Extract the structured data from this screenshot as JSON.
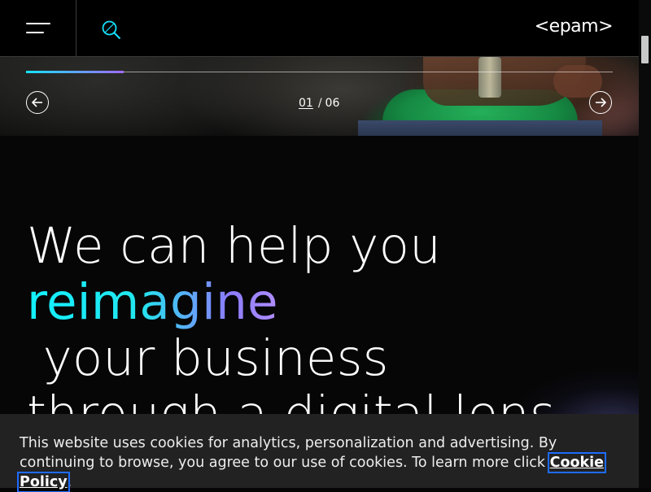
{
  "header": {
    "logo_text": "<epam>",
    "icons": {
      "menu": "hamburger-icon",
      "search": "search-icon"
    },
    "accent_color": "#14e3ff"
  },
  "carousel": {
    "current": "01",
    "separator": "/",
    "total": "06",
    "progress_fraction": 0.1667,
    "icons": {
      "prev": "arrow-left-icon",
      "next": "arrow-right-icon"
    }
  },
  "headline": {
    "line1": "We can help you",
    "highlight": "reimagine",
    "line2_rest": " your business",
    "line3": "through a digital lens.",
    "highlight_gradient": [
      "#13f0ff",
      "#b08dff"
    ]
  },
  "cookie_banner": {
    "text": "This website uses cookies for analytics, personalization and advertising. By continuing to browse, you agree to our use of cookies. To learn more click ",
    "link_label": "Cookie Policy",
    "trailing": "."
  }
}
